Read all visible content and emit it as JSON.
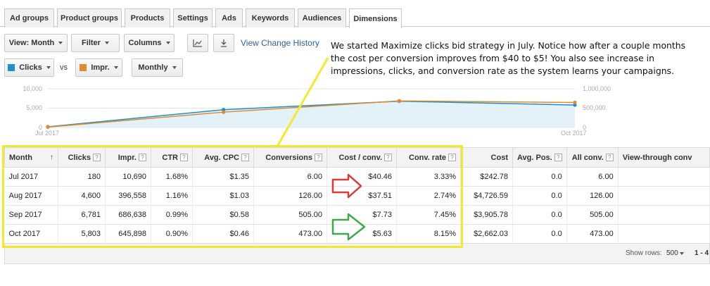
{
  "tabs": [
    "Ad groups",
    "Product groups",
    "Products",
    "Settings",
    "Ads",
    "Keywords",
    "Audiences",
    "Dimensions"
  ],
  "toolbar": {
    "view": "View: Month",
    "filter": "Filter",
    "columns": "Columns",
    "link": "View Change History",
    "metric1": "Clicks",
    "vs": "vs",
    "metric2": "Impr.",
    "period": "Monthly"
  },
  "annotation": "We started Maximize clicks bid strategy in July. Notice how after a couple months the cost per conversion improves from $40 to $5! You also see increase in impressions, clicks, and conversion rate as the system learns your campaigns.",
  "colors": {
    "clicks": "#1c8fd0",
    "impressions": "#e08a2c",
    "highlight": "#f4ea2d",
    "red_arrow": "#e0383a",
    "green_arrow": "#3aaa4a",
    "link": "#2a5db0"
  },
  "chart_data": {
    "type": "line",
    "x": [
      "Jul 2017",
      "Aug 2017",
      "Sep 2017",
      "Oct 2017"
    ],
    "x_tick_labels": [
      "Jul 2017",
      "Oct 2017"
    ],
    "series": [
      {
        "name": "Clicks",
        "axis": "left",
        "values": [
          180,
          4600,
          6781,
          5803
        ]
      },
      {
        "name": "Impr.",
        "axis": "right",
        "values": [
          10690,
          396558,
          686638,
          645898
        ]
      }
    ],
    "y_left": {
      "ticks": [
        "10,000",
        "5,000",
        "0"
      ],
      "range": [
        0,
        10000
      ]
    },
    "y_right": {
      "ticks": [
        "1,000,000",
        "500,000",
        "0"
      ],
      "range": [
        0,
        1000000
      ]
    }
  },
  "table": {
    "columns": [
      "Month",
      "Clicks",
      "Impr.",
      "CTR",
      "Avg. CPC",
      "Conversions",
      "Cost / conv.",
      "Conv. rate",
      "Cost",
      "Avg. Pos.",
      "All conv.",
      "View-through conv"
    ],
    "rows": [
      [
        "Jul 2017",
        "180",
        "10,690",
        "1.68%",
        "$1.35",
        "6.00",
        "$40.46",
        "3.33%",
        "$242.78",
        "0.0",
        "6.00",
        ""
      ],
      [
        "Aug 2017",
        "4,600",
        "396,558",
        "1.16%",
        "$1.03",
        "126.00",
        "$37.51",
        "2.74%",
        "$4,726.59",
        "0.0",
        "126.00",
        ""
      ],
      [
        "Sep 2017",
        "6,781",
        "686,638",
        "0.99%",
        "$0.58",
        "505.00",
        "$7.73",
        "7.45%",
        "$3,905.78",
        "0.0",
        "505.00",
        ""
      ],
      [
        "Oct 2017",
        "5,803",
        "645,898",
        "0.90%",
        "$0.46",
        "473.00",
        "$5.63",
        "8.15%",
        "$2,662.03",
        "0.0",
        "473.00",
        ""
      ]
    ]
  },
  "footer": {
    "show_rows_label": "Show rows:",
    "rows_value": "500",
    "range": "1 - 4"
  }
}
